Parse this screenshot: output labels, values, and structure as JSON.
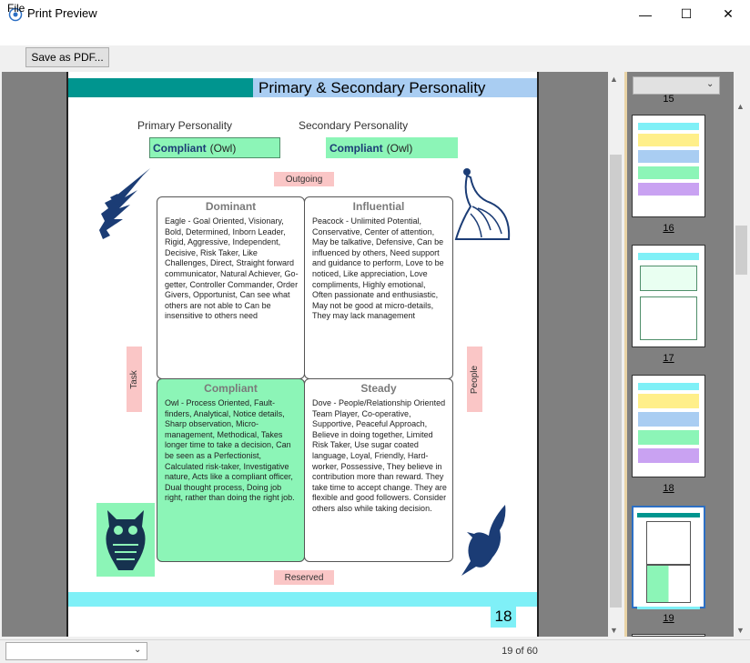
{
  "window": {
    "title": "Print Preview",
    "minimize": "—",
    "maximize": "☐",
    "close": "✕"
  },
  "menu": {
    "file": "File"
  },
  "toolbar": {
    "save_pdf": "Save as PDF..."
  },
  "page": {
    "title": "Primary & Secondary Personality",
    "primary_label": "Primary Personality",
    "secondary_label": "Secondary Personality",
    "primary_value_bold": "Compliant",
    "primary_value_rest": "(Owl)",
    "secondary_value_bold": "Compliant",
    "secondary_value_rest": "(Owl)",
    "tag_top": "Outgoing",
    "tag_bottom": "Reserved",
    "tag_left": "Task",
    "tag_right": "People",
    "quadrants": [
      {
        "title": "Dominant",
        "text": "Eagle - Goal Oriented, Visionary, Bold, Determined, Inborn Leader, Rigid, Aggressive, Independent, Decisive, Risk Taker, Like Challenges, Direct, Straight forward communicator, Natural Achiever, Go-getter, Controller Commander, Order Givers, Opportunist, Can see what others are not able to Can be insensitive to others need",
        "highlight": false
      },
      {
        "title": "Influential",
        "text": "Peacock - Unlimited Potential, Conservative, Center of attention, May be talkative, Defensive, Can be influenced by others, Need support and guidance to perform, Love to be noticed, Like appreciation, Love compliments, Highly emotional, Often passionate and enthusiastic, May not be good at micro-details, They may lack management",
        "highlight": false
      },
      {
        "title": "Compliant",
        "text": "Owl - Process Oriented, Fault-finders, Analytical, Notice details, Sharp observation, Micro-management, Methodical, Takes longer time to take a decision, Can be seen as a Perfectionist, Calculated risk-taker, Investigative nature, Acts like a compliant officer, Dual thought process, Doing job right, rather than doing the right job.",
        "highlight": true
      },
      {
        "title": "Steady",
        "text": "Dove - People/Relationship Oriented Team Player, Co-operative, Supportive, Peaceful Approach, Believe in doing together, Limited Risk Taker, Use sugar coated language, Loyal, Friendly, Hard-worker, Possessive, They believe in contribution more than reward. They take time to accept change. They are flexible and good followers. Consider others also while taking decision.",
        "highlight": false
      }
    ],
    "page_number": "18"
  },
  "thumbnails": [
    {
      "label": "16"
    },
    {
      "label": "17"
    },
    {
      "label": "18"
    },
    {
      "label": "19"
    }
  ],
  "thumb_partial_label": "15",
  "status": {
    "page_indicator": "19 of 60"
  },
  "colors": {
    "accent_green": "#8cf5b7",
    "header_teal": "#00958f",
    "header_blue": "#a9cdf2",
    "tag_pink": "#fac6c6",
    "footer_cyan": "#7ff0f7",
    "icon_navy": "#1b3c75"
  }
}
